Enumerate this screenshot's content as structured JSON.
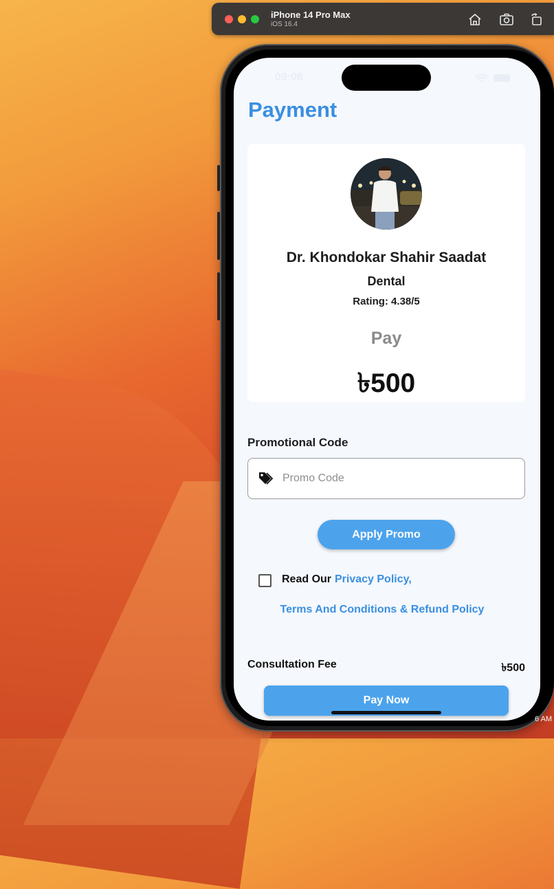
{
  "simulator": {
    "device": "iPhone 14 Pro Max",
    "os": "iOS 16.4"
  },
  "status_bar": {
    "time": "09:08"
  },
  "page": {
    "title": "Payment"
  },
  "doctor": {
    "name": "Dr. Khondokar Shahir Saadat",
    "specialty": "Dental",
    "rating": "Rating: 4.38/5"
  },
  "payment": {
    "pay_label": "Pay",
    "amount": "৳500"
  },
  "promo": {
    "title": "Promotional Code",
    "placeholder": "Promo Code",
    "value": "",
    "apply_label": "Apply Promo"
  },
  "policy": {
    "read_our": "Read Our",
    "privacy_link": "Privacy Policy,",
    "terms_link": "Terms And Conditions & Refund Policy",
    "checked": false
  },
  "fee": {
    "label": "Consultation Fee",
    "value": "৳500"
  },
  "actions": {
    "pay_now_label": "Pay Now"
  },
  "desktop": {
    "corner_clock": "6 AM"
  },
  "colors": {
    "accent": "#3a8fe0",
    "button": "#4ca3ec",
    "screen_bg": "#f5f8fd"
  }
}
